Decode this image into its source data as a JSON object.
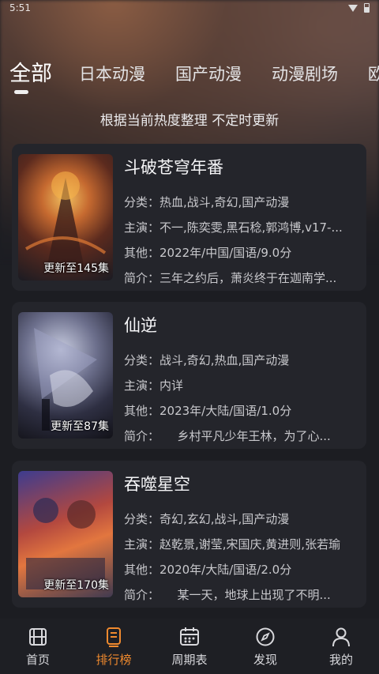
{
  "status": {
    "time": "5:51"
  },
  "tabs": [
    {
      "label": "全部",
      "active": true
    },
    {
      "label": "日本动漫"
    },
    {
      "label": "国产动漫"
    },
    {
      "label": "动漫剧场"
    },
    {
      "label": "欧"
    }
  ],
  "subtitle": "根据当前热度整理 不定时更新",
  "shows": [
    {
      "title": "斗破苍穹年番",
      "poster_label": "更新至145集",
      "category": "分类：热血,战斗,奇幻,国产动漫",
      "cast": "主演：不一,陈奕雯,黑石稔,郭鸿博,v17-...",
      "other": "其他：2022年/中国/国语/9.0分",
      "intro": "简介：三年之约后，萧炎终于在迦南学..."
    },
    {
      "title": "仙逆",
      "poster_label": "更新至87集",
      "category": "分类：战斗,奇幻,热血,国产动漫",
      "cast": "主演：内详",
      "other": "其他：2023年/大陆/国语/1.0分",
      "intro": "简介：　　乡村平凡少年王林，为了心..."
    },
    {
      "title": "吞噬星空",
      "poster_label": "更新至170集",
      "category": "分类：奇幻,玄幻,战斗,国产动漫",
      "cast": "主演：赵乾景,谢莹,宋国庆,黄进则,张若瑜",
      "other": "其他：2020年/大陆/国语/2.0分",
      "intro": "简介：　　某一天，地球上出现了不明..."
    }
  ],
  "nav": [
    {
      "label": "首页",
      "icon": "film-icon"
    },
    {
      "label": "排行榜",
      "icon": "ranking-icon",
      "active": true
    },
    {
      "label": "周期表",
      "icon": "calendar-icon"
    },
    {
      "label": "发现",
      "icon": "compass-icon"
    },
    {
      "label": "我的",
      "icon": "user-icon"
    }
  ],
  "colors": {
    "accent": "#f08a2e",
    "card": "#24252b",
    "background": "#1c1d22"
  }
}
